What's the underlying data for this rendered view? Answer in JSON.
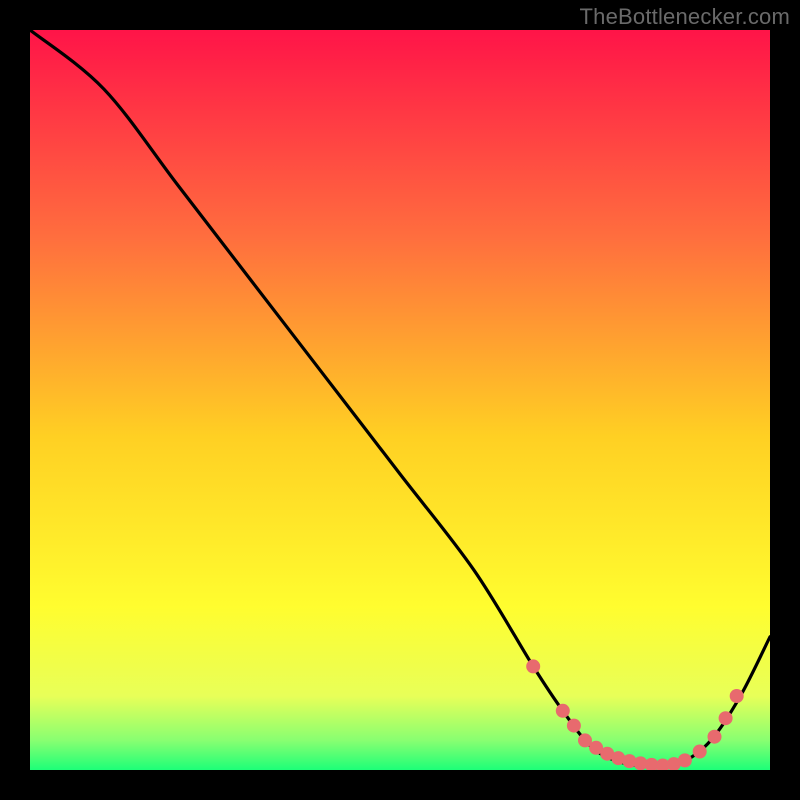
{
  "attribution": "TheBottlenecker.com",
  "chart_data": {
    "type": "line",
    "title": "",
    "xlabel": "",
    "ylabel": "",
    "xlim": [
      0,
      100
    ],
    "ylim": [
      0,
      100
    ],
    "x": [
      0,
      10,
      20,
      30,
      40,
      50,
      60,
      68,
      72,
      76,
      80,
      84,
      88,
      92,
      96,
      100
    ],
    "values": [
      100,
      92,
      79,
      66,
      53,
      40,
      27,
      14,
      8,
      3,
      1,
      0.5,
      1,
      4,
      10,
      18
    ],
    "dot_x": [
      68,
      72,
      73.5,
      75,
      76.5,
      78,
      79.5,
      81,
      82.5,
      84,
      85.5,
      87,
      88.5,
      90.5,
      92.5,
      94,
      95.5
    ],
    "dot_y": [
      14,
      8,
      6,
      4,
      3,
      2.2,
      1.6,
      1.2,
      0.9,
      0.7,
      0.6,
      0.8,
      1.3,
      2.5,
      4.5,
      7,
      10
    ],
    "gradient_stops": [
      {
        "offset": 0,
        "color": "#ff1448"
      },
      {
        "offset": 28,
        "color": "#ff6e3e"
      },
      {
        "offset": 55,
        "color": "#ffd023"
      },
      {
        "offset": 78,
        "color": "#fffd2f"
      },
      {
        "offset": 90,
        "color": "#e8ff58"
      },
      {
        "offset": 96,
        "color": "#88ff71"
      },
      {
        "offset": 100,
        "color": "#1dff78"
      }
    ],
    "line_color": "#000000",
    "dot_color": "#e86a6e",
    "dot_radius": 7,
    "line_width": 3.2
  }
}
